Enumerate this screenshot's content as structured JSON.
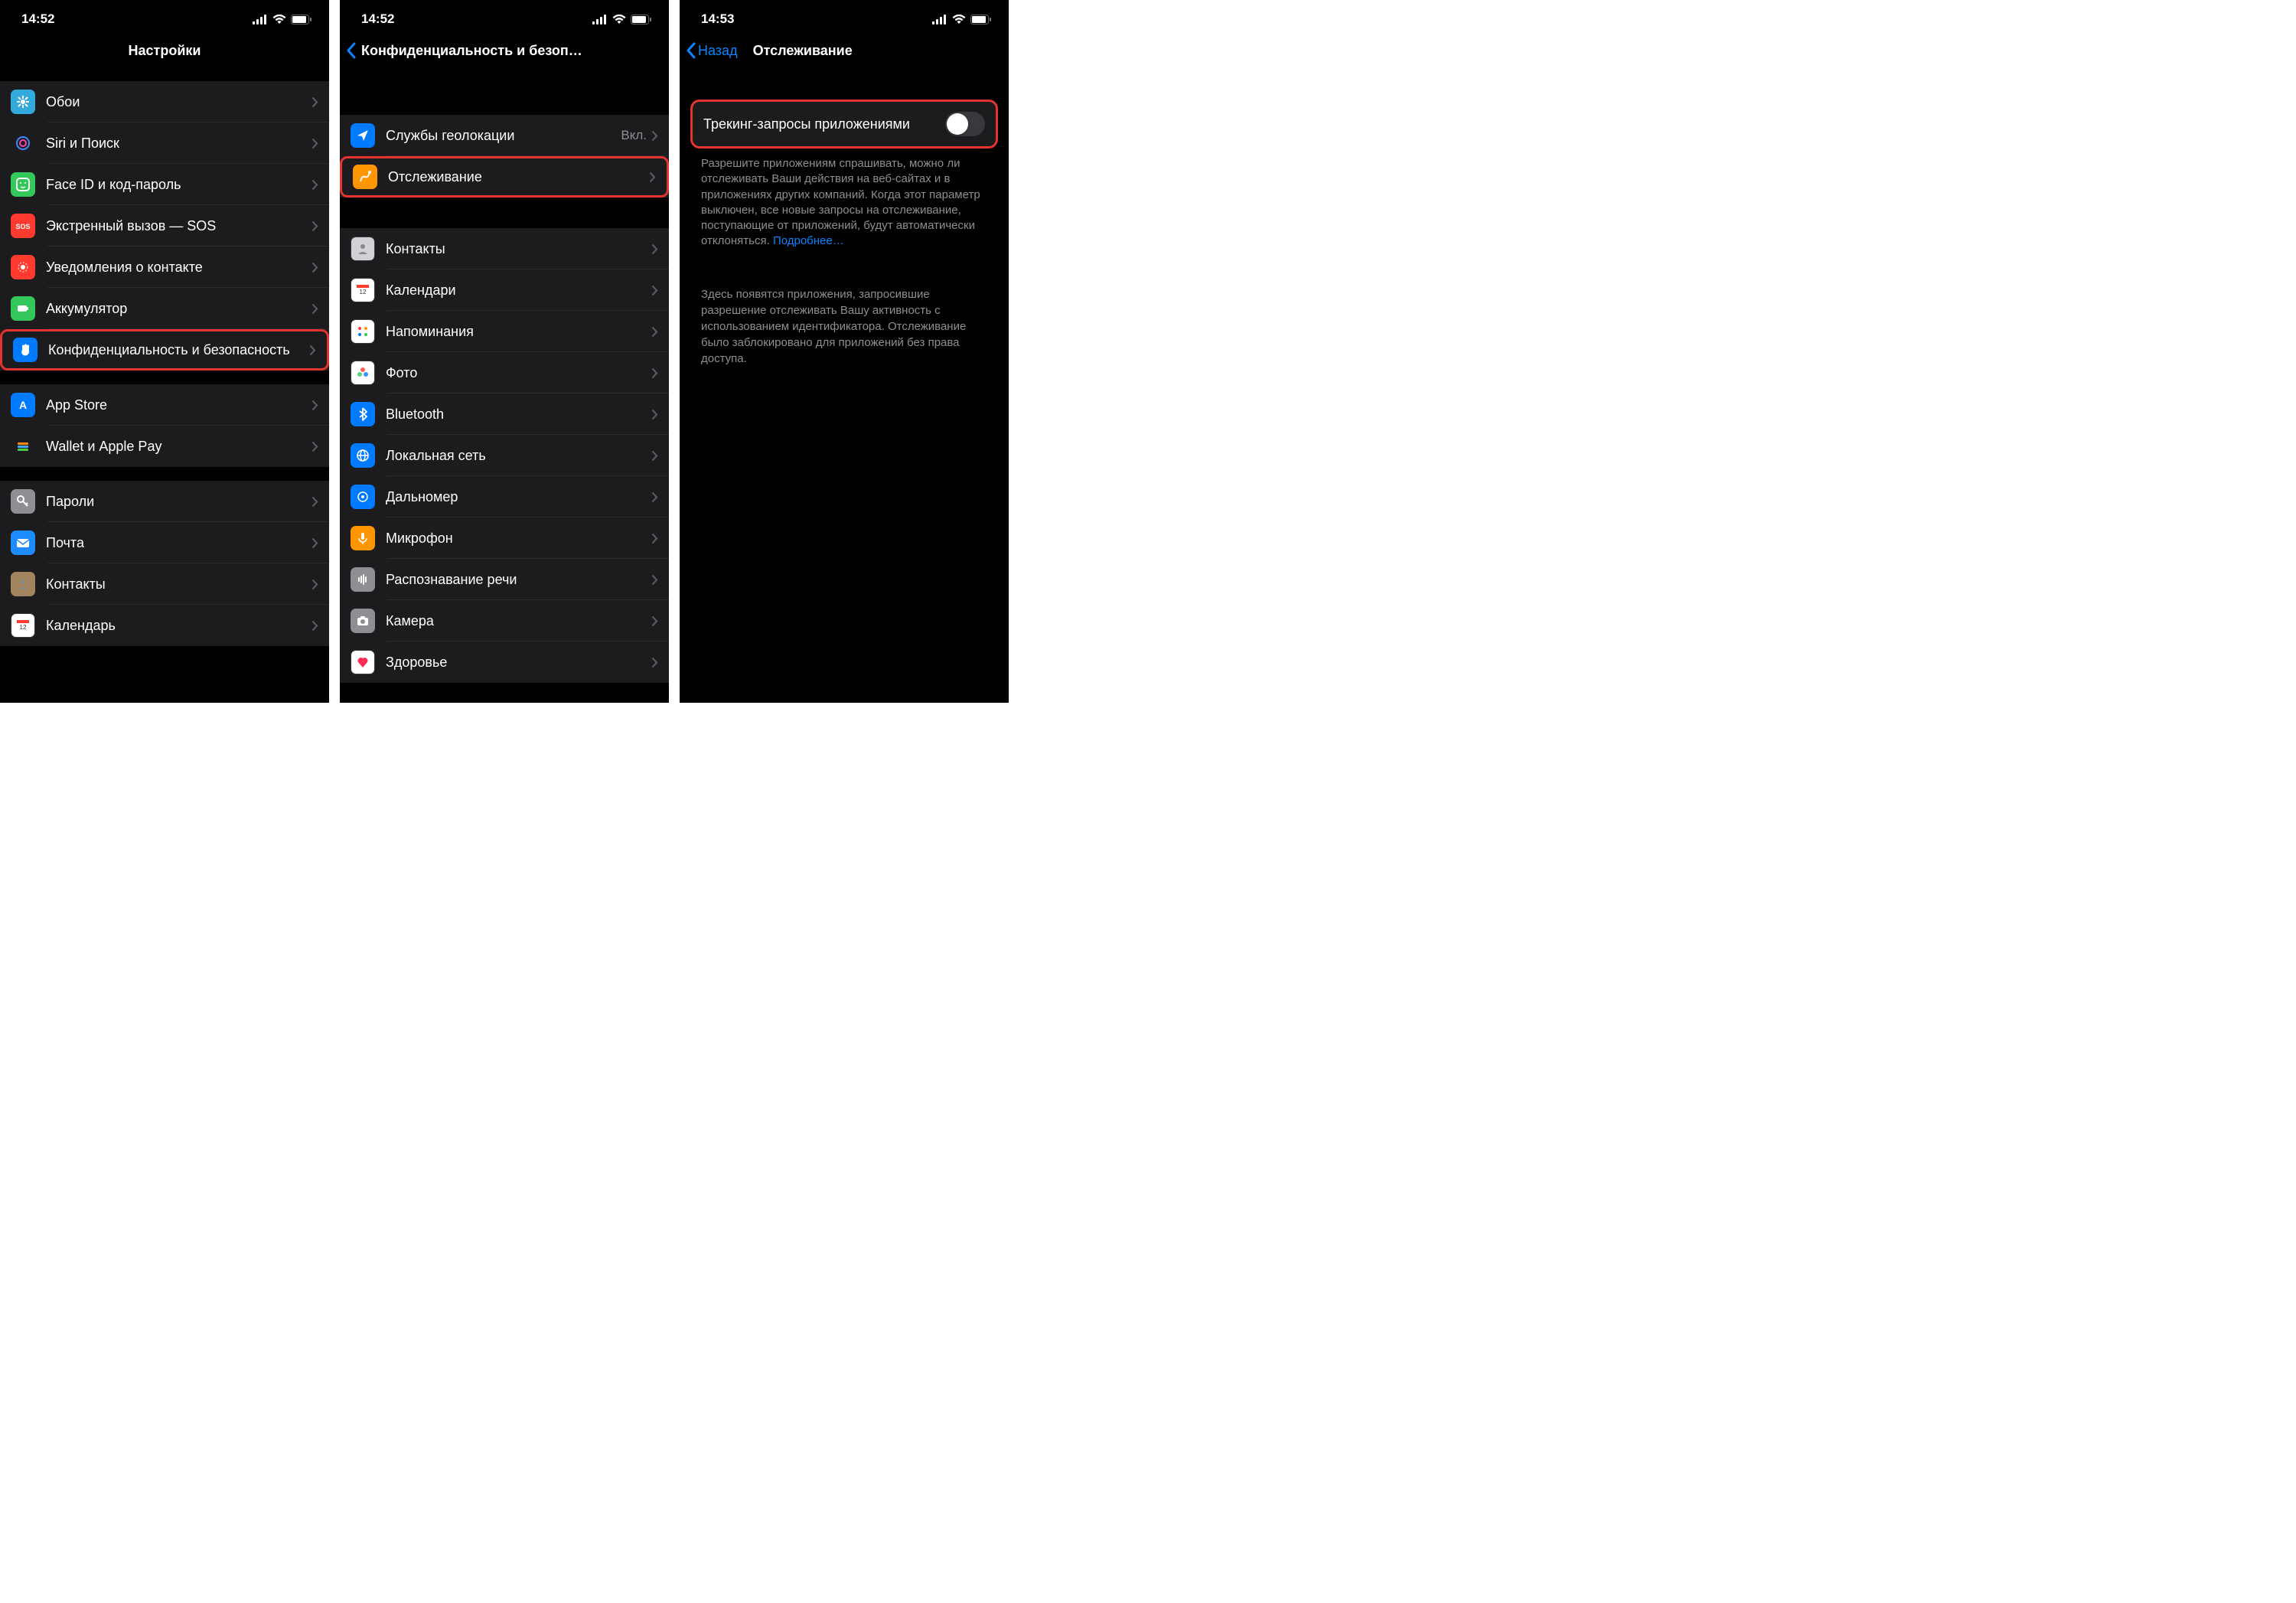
{
  "screen1": {
    "time": "14:52",
    "title": "Настройки",
    "items": [
      {
        "label": "Обои",
        "iconColor": "#34aadc",
        "icon": "flower"
      },
      {
        "label": "Siri и Поиск",
        "iconColor": "#1c1c1e",
        "icon": "siri"
      },
      {
        "label": "Face ID и код-пароль",
        "iconColor": "#34c759",
        "icon": "faceid"
      },
      {
        "label": "Экстренный вызов — SOS",
        "iconColor": "#ff3b30",
        "icon": "sos"
      },
      {
        "label": "Уведомления о контакте",
        "iconColor": "#ff3b30",
        "icon": "exposure"
      },
      {
        "label": "Аккумулятор",
        "iconColor": "#34c759",
        "icon": "battery"
      },
      {
        "label": "Конфиденциальность и безопасность",
        "iconColor": "#007aff",
        "icon": "hand",
        "highlight": true
      }
    ],
    "items2": [
      {
        "label": "App Store",
        "iconColor": "#007aff",
        "icon": "appstore"
      },
      {
        "label": "Wallet и Apple Pay",
        "iconColor": "#1c1c1e",
        "icon": "wallet"
      }
    ],
    "items3": [
      {
        "label": "Пароли",
        "iconColor": "#8e8e93",
        "icon": "key"
      },
      {
        "label": "Почта",
        "iconColor": "#1d8cff",
        "icon": "mail"
      },
      {
        "label": "Контакты",
        "iconColor": "#a2845e",
        "icon": "contacts"
      },
      {
        "label": "Календарь",
        "iconColor": "#ffffff",
        "icon": "calendar"
      }
    ]
  },
  "screen2": {
    "time": "14:52",
    "title": "Конфиденциальность и безоп…",
    "group1": [
      {
        "label": "Службы геолокации",
        "value": "Вкл.",
        "iconColor": "#007aff",
        "icon": "location"
      },
      {
        "label": "Отслеживание",
        "iconColor": "#ff9500",
        "icon": "tracking",
        "highlight": true
      }
    ],
    "group2": [
      {
        "label": "Контакты",
        "iconColor": "#d1d1d6",
        "icon": "contacts2"
      },
      {
        "label": "Календари",
        "iconColor": "#ffffff",
        "icon": "calendar2"
      },
      {
        "label": "Напоминания",
        "iconColor": "#ffffff",
        "icon": "reminders"
      },
      {
        "label": "Фото",
        "iconColor": "#ffffff",
        "icon": "photos"
      },
      {
        "label": "Bluetooth",
        "iconColor": "#007aff",
        "icon": "bluetooth"
      },
      {
        "label": "Локальная сеть",
        "iconColor": "#007aff",
        "icon": "network"
      },
      {
        "label": "Дальномер",
        "iconColor": "#007aff",
        "icon": "ruler"
      },
      {
        "label": "Микрофон",
        "iconColor": "#ff9500",
        "icon": "mic"
      },
      {
        "label": "Распознавание речи",
        "iconColor": "#8e8e93",
        "icon": "speech"
      },
      {
        "label": "Камера",
        "iconColor": "#8e8e93",
        "icon": "camera"
      },
      {
        "label": "Здоровье",
        "iconColor": "#ffffff",
        "icon": "health"
      }
    ]
  },
  "screen3": {
    "time": "14:53",
    "back": "Назад",
    "title": "Отслеживание",
    "toggleLabel": "Трекинг-запросы приложениями",
    "footer1": "Разрешите приложениям спрашивать, можно ли отслеживать Ваши действия на веб-сайтах и в приложениях других компаний. Когда этот параметр выключен, все новые запросы на отслеживание, поступающие от приложений, будут автоматически отклоняться.",
    "footer1Link": "Подробнее…",
    "footer2": "Здесь появятся приложения, запросившие разрешение отслеживать Вашу активность с использованием идентификатора. Отслеживание было заблокировано для приложений без права доступа."
  }
}
